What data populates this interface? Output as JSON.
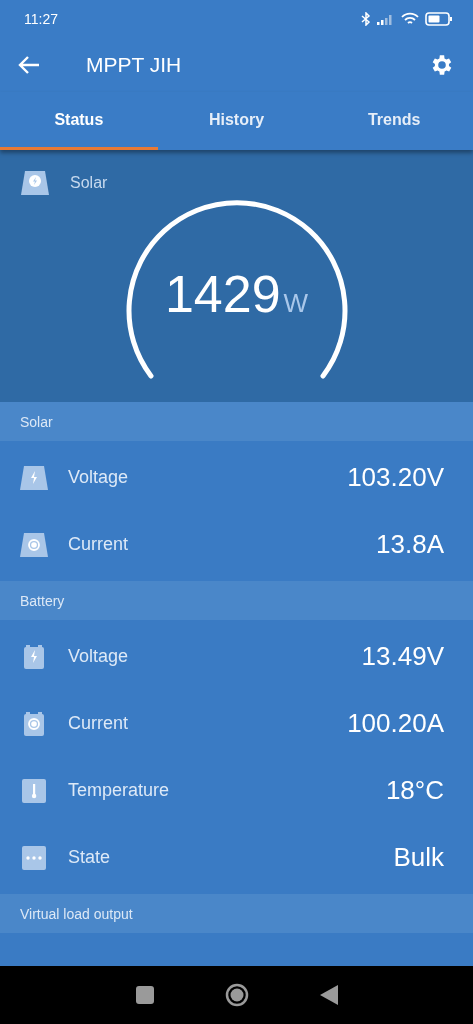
{
  "status_bar": {
    "time": "11:27"
  },
  "app_bar": {
    "title": "MPPT JIH"
  },
  "tabs": [
    {
      "label": "Status",
      "selected": true
    },
    {
      "label": "History",
      "selected": false
    },
    {
      "label": "Trends",
      "selected": false
    }
  ],
  "gauge": {
    "label": "Solar",
    "value": "1429",
    "unit": "W"
  },
  "sections": [
    {
      "title": "Solar",
      "rows": [
        {
          "kind": "panel-bolt",
          "label": "Voltage",
          "value": "103.20V"
        },
        {
          "kind": "panel-dot",
          "label": "Current",
          "value": "13.8A"
        }
      ]
    },
    {
      "title": "Battery",
      "rows": [
        {
          "kind": "battery-bolt",
          "label": "Voltage",
          "value": "13.49V"
        },
        {
          "kind": "battery-dot",
          "label": "Current",
          "value": "100.20A"
        },
        {
          "kind": "thermometer",
          "label": "Temperature",
          "value": "18°C"
        },
        {
          "kind": "dots",
          "label": "State",
          "value": "Bulk"
        }
      ]
    },
    {
      "title": "Virtual load output"
    }
  ]
}
